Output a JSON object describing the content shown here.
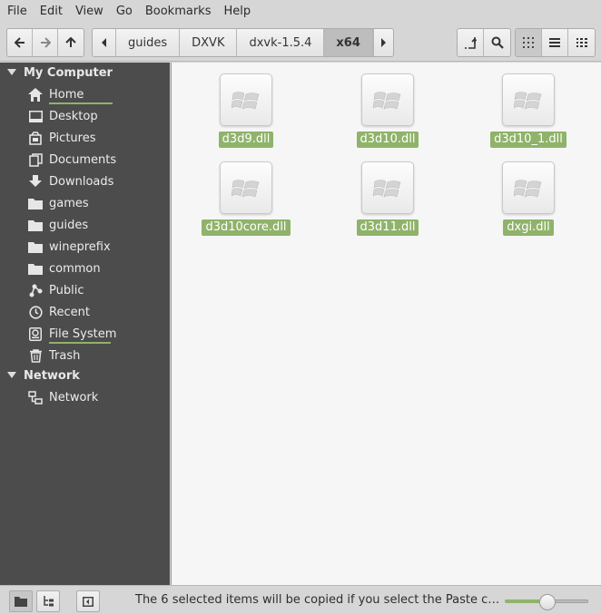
{
  "menubar": {
    "items": [
      "File",
      "Edit",
      "View",
      "Go",
      "Bookmarks",
      "Help"
    ]
  },
  "breadcrumbs": [
    "guides",
    "DXVK",
    "dxvk-1.5.4",
    "x64"
  ],
  "active_breadcrumb": "x64",
  "sidebar": {
    "my_computer_label": "My Computer",
    "network_section_label": "Network",
    "items": [
      {
        "label": "Home",
        "icon": "home-icon"
      },
      {
        "label": "Desktop",
        "icon": "desktop-icon"
      },
      {
        "label": "Pictures",
        "icon": "pictures-icon"
      },
      {
        "label": "Documents",
        "icon": "documents-icon"
      },
      {
        "label": "Downloads",
        "icon": "downloads-icon"
      },
      {
        "label": "games",
        "icon": "folder-icon"
      },
      {
        "label": "guides",
        "icon": "folder-icon"
      },
      {
        "label": "wineprefix",
        "icon": "folder-icon"
      },
      {
        "label": "common",
        "icon": "folder-icon"
      },
      {
        "label": "Public",
        "icon": "share-icon"
      },
      {
        "label": "Recent",
        "icon": "clock-icon"
      },
      {
        "label": "File System",
        "icon": "drive-icon"
      },
      {
        "label": "Trash",
        "icon": "trash-icon"
      }
    ],
    "network_items": [
      {
        "label": "Network",
        "icon": "network-icon"
      }
    ]
  },
  "files": [
    {
      "name": "d3d9.dll"
    },
    {
      "name": "d3d10.dll"
    },
    {
      "name": "d3d10_1.dll"
    },
    {
      "name": "d3d10core.dll"
    },
    {
      "name": "d3d11.dll"
    },
    {
      "name": "dxgi.dll"
    }
  ],
  "status": {
    "text": "The 6 selected items will be copied if you select the Paste c…"
  },
  "zoom_fraction": 0.5,
  "colors": {
    "selection": "#8fb36a",
    "sidebar_bg": "#4c4c4c",
    "chrome_bg": "#d6d6d6"
  }
}
